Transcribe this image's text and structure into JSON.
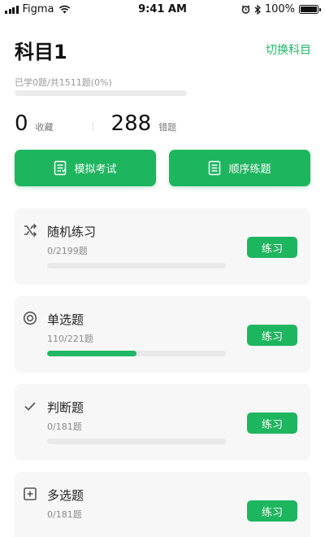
{
  "status_bar": {
    "carrier": "Figma",
    "time": "9:41 AM",
    "battery": "100%",
    "icons": [
      "signal-icon",
      "wifi-icon",
      "alarm-icon",
      "bluetooth-icon",
      "battery-icon"
    ]
  },
  "header": {
    "title": "科目1",
    "switch_label": "切换科目",
    "learned_text": "已学0题/共1511题(0%)",
    "learned_progress": 0
  },
  "stats": {
    "favorites_count": "0",
    "favorites_label": "收藏",
    "wrong_count": "288",
    "wrong_label": "错题"
  },
  "actions": {
    "mock_exam_label": "模拟考试",
    "sequential_label": "顺序练题"
  },
  "practice_cards": [
    {
      "title": "随机练习",
      "count": "0/2199题",
      "progress": 0,
      "button": "练习",
      "icon": "shuffle-icon"
    },
    {
      "title": "单选题",
      "count": "110/221题",
      "progress": 0.498,
      "button": "练习",
      "icon": "radio-icon"
    },
    {
      "title": "判断题",
      "count": "0/181题",
      "progress": 0,
      "button": "练习",
      "icon": "check-icon"
    },
    {
      "title": "多选题",
      "count": "0/181题",
      "progress": 0,
      "button": "练习",
      "icon": "plus-square-icon"
    }
  ],
  "colors": {
    "accent": "#1eb55f",
    "link": "#20b866",
    "card_bg": "#f7f7f7"
  }
}
